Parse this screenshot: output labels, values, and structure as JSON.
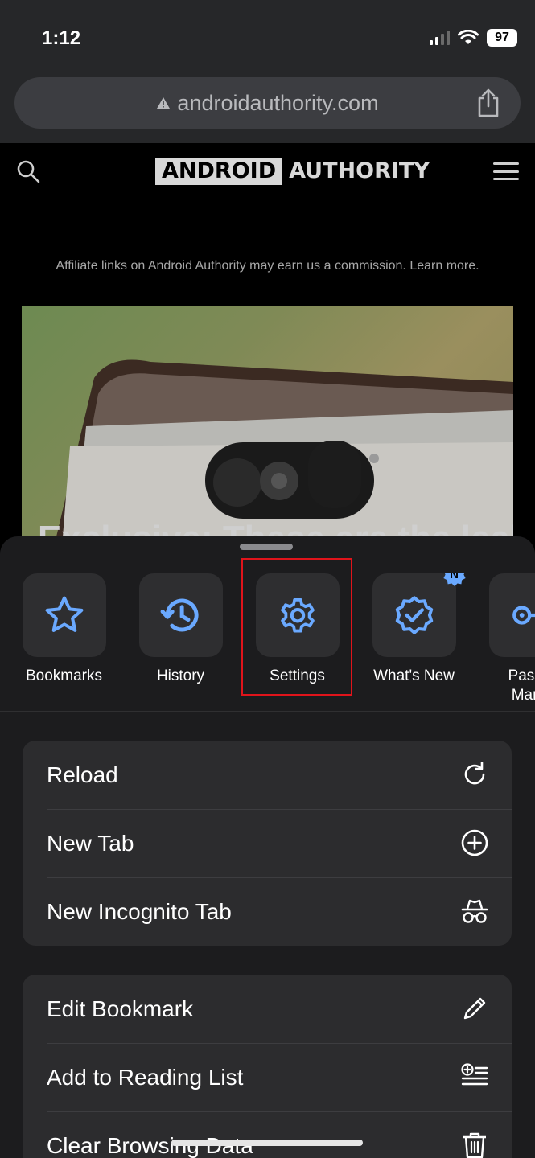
{
  "status": {
    "time": "1:12",
    "battery": "97"
  },
  "browser": {
    "url": "androidauthority.com"
  },
  "site": {
    "logo_boxed": "ANDROID",
    "logo_plain": "AUTHORITY",
    "affiliate_text": "Affiliate links on Android Authority may earn us a commission. Learn more.",
    "hero_title": "Exclusive: These are the leaked"
  },
  "menu": {
    "destinations": [
      {
        "label": "Bookmarks",
        "icon": "star-icon"
      },
      {
        "label": "History",
        "icon": "history-icon"
      },
      {
        "label": "Settings",
        "icon": "gear-icon"
      },
      {
        "label": "What's New",
        "icon": "verified-badge-icon",
        "badge": "N"
      },
      {
        "label": "Passw\nMana",
        "icon": "key-icon"
      }
    ],
    "group1": [
      {
        "label": "Reload",
        "icon": "reload-icon"
      },
      {
        "label": "New Tab",
        "icon": "plus-circle-icon"
      },
      {
        "label": "New Incognito Tab",
        "icon": "incognito-icon"
      }
    ],
    "group2": [
      {
        "label": "Edit Bookmark",
        "icon": "pencil-icon"
      },
      {
        "label": "Add to Reading List",
        "icon": "reading-list-add-icon"
      },
      {
        "label": "Clear Browsing Data",
        "icon": "trash-icon"
      }
    ]
  },
  "colors": {
    "accent": "#6aa9ff",
    "highlight": "#e0141b",
    "sheet": "#1c1c1e",
    "tile": "#2e2e30"
  }
}
